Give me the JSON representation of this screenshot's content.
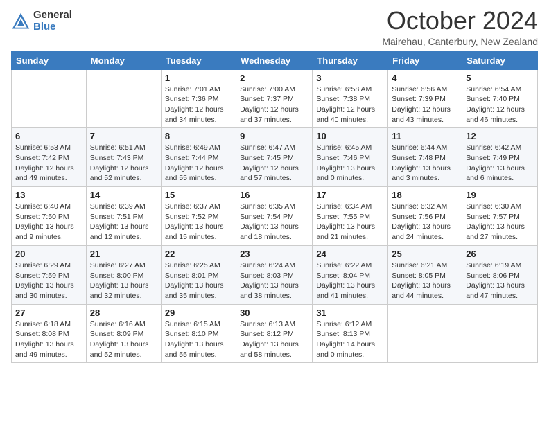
{
  "logo": {
    "general": "General",
    "blue": "Blue"
  },
  "title": "October 2024",
  "subtitle": "Mairehau, Canterbury, New Zealand",
  "days_of_week": [
    "Sunday",
    "Monday",
    "Tuesday",
    "Wednesday",
    "Thursday",
    "Friday",
    "Saturday"
  ],
  "weeks": [
    [
      {
        "day": "",
        "info": ""
      },
      {
        "day": "",
        "info": ""
      },
      {
        "day": "1",
        "info": "Sunrise: 7:01 AM\nSunset: 7:36 PM\nDaylight: 12 hours and 34 minutes."
      },
      {
        "day": "2",
        "info": "Sunrise: 7:00 AM\nSunset: 7:37 PM\nDaylight: 12 hours and 37 minutes."
      },
      {
        "day": "3",
        "info": "Sunrise: 6:58 AM\nSunset: 7:38 PM\nDaylight: 12 hours and 40 minutes."
      },
      {
        "day": "4",
        "info": "Sunrise: 6:56 AM\nSunset: 7:39 PM\nDaylight: 12 hours and 43 minutes."
      },
      {
        "day": "5",
        "info": "Sunrise: 6:54 AM\nSunset: 7:40 PM\nDaylight: 12 hours and 46 minutes."
      }
    ],
    [
      {
        "day": "6",
        "info": "Sunrise: 6:53 AM\nSunset: 7:42 PM\nDaylight: 12 hours and 49 minutes."
      },
      {
        "day": "7",
        "info": "Sunrise: 6:51 AM\nSunset: 7:43 PM\nDaylight: 12 hours and 52 minutes."
      },
      {
        "day": "8",
        "info": "Sunrise: 6:49 AM\nSunset: 7:44 PM\nDaylight: 12 hours and 55 minutes."
      },
      {
        "day": "9",
        "info": "Sunrise: 6:47 AM\nSunset: 7:45 PM\nDaylight: 12 hours and 57 minutes."
      },
      {
        "day": "10",
        "info": "Sunrise: 6:45 AM\nSunset: 7:46 PM\nDaylight: 13 hours and 0 minutes."
      },
      {
        "day": "11",
        "info": "Sunrise: 6:44 AM\nSunset: 7:48 PM\nDaylight: 13 hours and 3 minutes."
      },
      {
        "day": "12",
        "info": "Sunrise: 6:42 AM\nSunset: 7:49 PM\nDaylight: 13 hours and 6 minutes."
      }
    ],
    [
      {
        "day": "13",
        "info": "Sunrise: 6:40 AM\nSunset: 7:50 PM\nDaylight: 13 hours and 9 minutes."
      },
      {
        "day": "14",
        "info": "Sunrise: 6:39 AM\nSunset: 7:51 PM\nDaylight: 13 hours and 12 minutes."
      },
      {
        "day": "15",
        "info": "Sunrise: 6:37 AM\nSunset: 7:52 PM\nDaylight: 13 hours and 15 minutes."
      },
      {
        "day": "16",
        "info": "Sunrise: 6:35 AM\nSunset: 7:54 PM\nDaylight: 13 hours and 18 minutes."
      },
      {
        "day": "17",
        "info": "Sunrise: 6:34 AM\nSunset: 7:55 PM\nDaylight: 13 hours and 21 minutes."
      },
      {
        "day": "18",
        "info": "Sunrise: 6:32 AM\nSunset: 7:56 PM\nDaylight: 13 hours and 24 minutes."
      },
      {
        "day": "19",
        "info": "Sunrise: 6:30 AM\nSunset: 7:57 PM\nDaylight: 13 hours and 27 minutes."
      }
    ],
    [
      {
        "day": "20",
        "info": "Sunrise: 6:29 AM\nSunset: 7:59 PM\nDaylight: 13 hours and 30 minutes."
      },
      {
        "day": "21",
        "info": "Sunrise: 6:27 AM\nSunset: 8:00 PM\nDaylight: 13 hours and 32 minutes."
      },
      {
        "day": "22",
        "info": "Sunrise: 6:25 AM\nSunset: 8:01 PM\nDaylight: 13 hours and 35 minutes."
      },
      {
        "day": "23",
        "info": "Sunrise: 6:24 AM\nSunset: 8:03 PM\nDaylight: 13 hours and 38 minutes."
      },
      {
        "day": "24",
        "info": "Sunrise: 6:22 AM\nSunset: 8:04 PM\nDaylight: 13 hours and 41 minutes."
      },
      {
        "day": "25",
        "info": "Sunrise: 6:21 AM\nSunset: 8:05 PM\nDaylight: 13 hours and 44 minutes."
      },
      {
        "day": "26",
        "info": "Sunrise: 6:19 AM\nSunset: 8:06 PM\nDaylight: 13 hours and 47 minutes."
      }
    ],
    [
      {
        "day": "27",
        "info": "Sunrise: 6:18 AM\nSunset: 8:08 PM\nDaylight: 13 hours and 49 minutes."
      },
      {
        "day": "28",
        "info": "Sunrise: 6:16 AM\nSunset: 8:09 PM\nDaylight: 13 hours and 52 minutes."
      },
      {
        "day": "29",
        "info": "Sunrise: 6:15 AM\nSunset: 8:10 PM\nDaylight: 13 hours and 55 minutes."
      },
      {
        "day": "30",
        "info": "Sunrise: 6:13 AM\nSunset: 8:12 PM\nDaylight: 13 hours and 58 minutes."
      },
      {
        "day": "31",
        "info": "Sunrise: 6:12 AM\nSunset: 8:13 PM\nDaylight: 14 hours and 0 minutes."
      },
      {
        "day": "",
        "info": ""
      },
      {
        "day": "",
        "info": ""
      }
    ]
  ]
}
